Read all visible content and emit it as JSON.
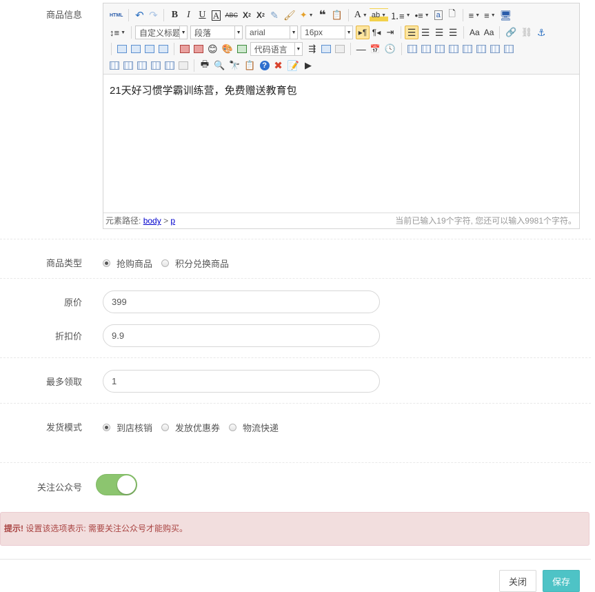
{
  "product_info": {
    "label": "商品信息",
    "toolbar": {
      "row1": [
        "HTML",
        "↶",
        "↷",
        "B",
        "I",
        "U",
        "A",
        "ABC",
        "X²",
        "X₂",
        "✎",
        "⌫",
        "✦",
        "❝",
        "⊡",
        "A",
        "ab",
        "≡",
        "≡",
        "a",
        "▢",
        "≡",
        "≡",
        "▣"
      ],
      "style_select": "自定义标题",
      "paragraph_select": "段落",
      "font_select": "arial",
      "size_select": "16px",
      "code_select": "代码语言"
    },
    "content": "21天好习惯学霸训练营，免费赠送教育包",
    "status": {
      "path_label": "元素路径:",
      "path_body": "body",
      "path_sep": ">",
      "path_p": "p",
      "count": "当前已输入19个字符, 您还可以输入9981个字符。"
    }
  },
  "product_type": {
    "label": "商品类型",
    "options": [
      "抢购商品",
      "积分兑换商品"
    ],
    "selected_index": 0
  },
  "original_price": {
    "label": "原价",
    "value": "399"
  },
  "discount_price": {
    "label": "折扣价",
    "value": "9.9"
  },
  "max_claim": {
    "label": "最多领取",
    "value": "1"
  },
  "delivery_mode": {
    "label": "发货模式",
    "options": [
      "到店核销",
      "发放优惠券",
      "物流快递"
    ],
    "selected_index": 0
  },
  "follow_account": {
    "label": "关注公众号",
    "enabled": true
  },
  "alert": {
    "strong": "提示!",
    "text": " 设置该选项表示: 需要关注公众号才能购买。"
  },
  "buttons": {
    "close": "关闭",
    "save": "保存"
  },
  "colors": {
    "toggle_on": "#8cc56f",
    "save": "#4ec3c6",
    "alert_bg": "#f2dede",
    "alert_text": "#a94442"
  }
}
